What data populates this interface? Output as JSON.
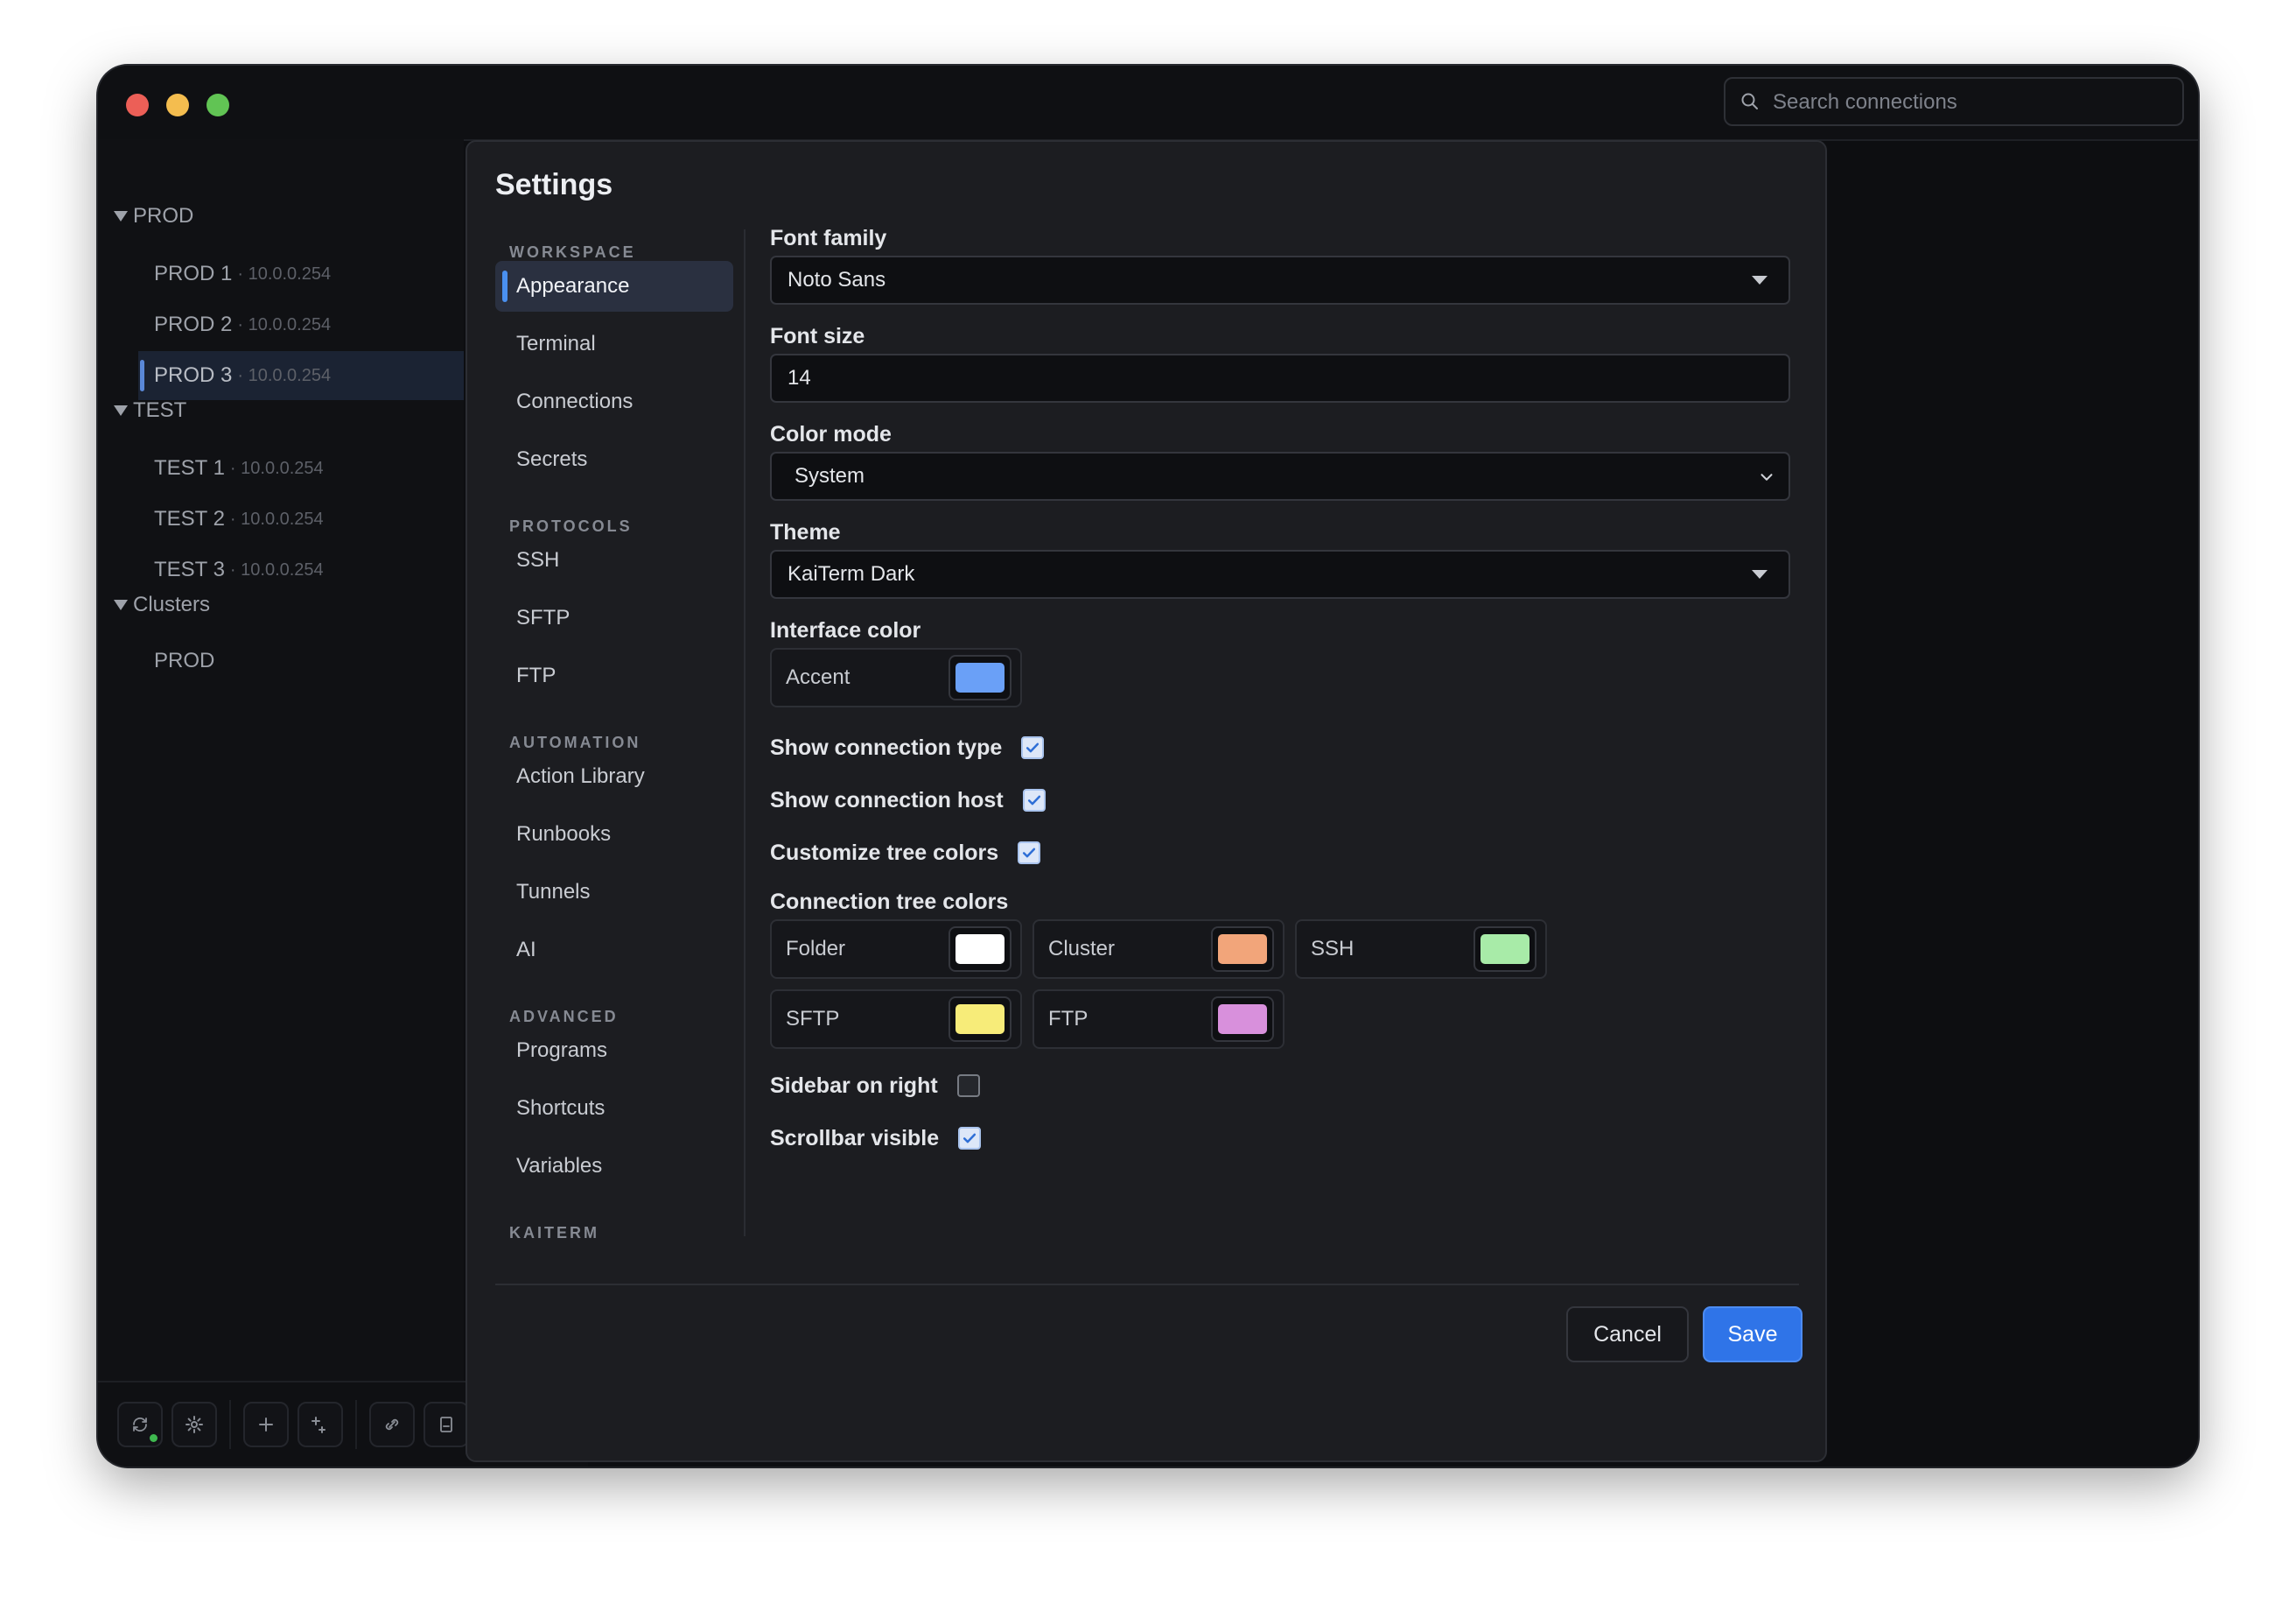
{
  "search": {
    "placeholder": "Search connections"
  },
  "tree": {
    "groups": [
      {
        "label": "PROD",
        "items": [
          {
            "name": "PROD 1",
            "host": "· 10.0.0.254"
          },
          {
            "name": "PROD 2",
            "host": "· 10.0.0.254"
          },
          {
            "name": "PROD 3",
            "host": "· 10.0.0.254"
          }
        ]
      },
      {
        "label": "TEST",
        "items": [
          {
            "name": "TEST 1",
            "host": "· 10.0.0.254"
          },
          {
            "name": "TEST 2",
            "host": "· 10.0.0.254"
          },
          {
            "name": "TEST 3",
            "host": "· 10.0.0.254"
          }
        ]
      },
      {
        "label": "Clusters",
        "items": [
          {
            "name": "PROD"
          }
        ]
      }
    ],
    "selected": "PROD 3"
  },
  "toolbar": {
    "icons": [
      "sync-icon",
      "gear-icon",
      "plus-icon",
      "add-folder-icon",
      "link-icon",
      "bookmark-icon",
      "terminal-icon"
    ]
  },
  "settings": {
    "title": "Settings",
    "nav": {
      "workspace_label": "WORKSPACE",
      "workspace": [
        "Appearance",
        "Terminal",
        "Connections",
        "Secrets"
      ],
      "protocols_label": "PROTOCOLS",
      "protocols": [
        "SSH",
        "SFTP",
        "FTP"
      ],
      "automation_label": "AUTOMATION",
      "automation": [
        "Action Library",
        "Runbooks",
        "Tunnels",
        "AI"
      ],
      "advanced_label": "ADVANCED",
      "advanced": [
        "Programs",
        "Shortcuts",
        "Variables"
      ],
      "kaiterm_label": "KAITERM",
      "active": "Appearance"
    },
    "appearance": {
      "font_family_label": "Font family",
      "font_family_value": "Noto Sans",
      "font_size_label": "Font size",
      "font_size_value": "14",
      "color_mode_label": "Color mode",
      "color_mode_value": "System",
      "theme_label": "Theme",
      "theme_value": "KaiTerm Dark",
      "interface_color_label": "Interface color",
      "accent_label": "Accent",
      "accent_color": "#6aa0f7",
      "show_connection_type_label": "Show connection type",
      "show_connection_type": true,
      "show_connection_host_label": "Show connection host",
      "show_connection_host": true,
      "customize_tree_colors_label": "Customize tree colors",
      "customize_tree_colors": true,
      "tree_colors_label": "Connection tree colors",
      "tree_colors": [
        {
          "label": "Folder",
          "color": "#ffffff"
        },
        {
          "label": "Cluster",
          "color": "#f2a57a"
        },
        {
          "label": "SSH",
          "color": "#a8eba8"
        },
        {
          "label": "SFTP",
          "color": "#f7ec79"
        },
        {
          "label": "FTP",
          "color": "#d890dc"
        }
      ],
      "sidebar_on_right_label": "Sidebar on right",
      "sidebar_on_right": false,
      "scrollbar_visible_label": "Scrollbar visible",
      "scrollbar_visible": true
    },
    "buttons": {
      "cancel": "Cancel",
      "save": "Save"
    }
  }
}
